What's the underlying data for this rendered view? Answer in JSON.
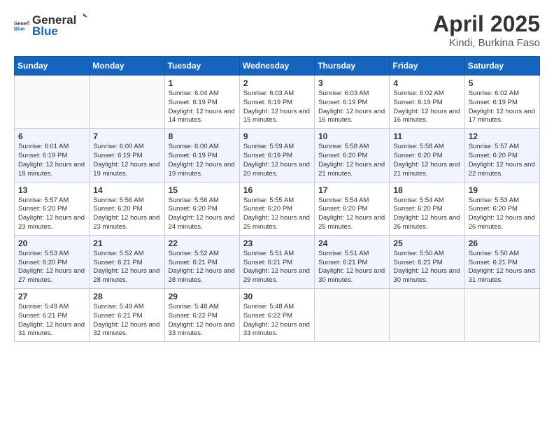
{
  "logo": {
    "general": "General",
    "blue": "Blue"
  },
  "title": {
    "month": "April 2025",
    "location": "Kindi, Burkina Faso"
  },
  "weekdays": [
    "Sunday",
    "Monday",
    "Tuesday",
    "Wednesday",
    "Thursday",
    "Friday",
    "Saturday"
  ],
  "weeks": [
    [
      {
        "day": "",
        "info": ""
      },
      {
        "day": "",
        "info": ""
      },
      {
        "day": "1",
        "info": "Sunrise: 6:04 AM\nSunset: 6:19 PM\nDaylight: 12 hours and 14 minutes."
      },
      {
        "day": "2",
        "info": "Sunrise: 6:03 AM\nSunset: 6:19 PM\nDaylight: 12 hours and 15 minutes."
      },
      {
        "day": "3",
        "info": "Sunrise: 6:03 AM\nSunset: 6:19 PM\nDaylight: 12 hours and 16 minutes."
      },
      {
        "day": "4",
        "info": "Sunrise: 6:02 AM\nSunset: 6:19 PM\nDaylight: 12 hours and 16 minutes."
      },
      {
        "day": "5",
        "info": "Sunrise: 6:02 AM\nSunset: 6:19 PM\nDaylight: 12 hours and 17 minutes."
      }
    ],
    [
      {
        "day": "6",
        "info": "Sunrise: 6:01 AM\nSunset: 6:19 PM\nDaylight: 12 hours and 18 minutes."
      },
      {
        "day": "7",
        "info": "Sunrise: 6:00 AM\nSunset: 6:19 PM\nDaylight: 12 hours and 19 minutes."
      },
      {
        "day": "8",
        "info": "Sunrise: 6:00 AM\nSunset: 6:19 PM\nDaylight: 12 hours and 19 minutes."
      },
      {
        "day": "9",
        "info": "Sunrise: 5:59 AM\nSunset: 6:19 PM\nDaylight: 12 hours and 20 minutes."
      },
      {
        "day": "10",
        "info": "Sunrise: 5:58 AM\nSunset: 6:20 PM\nDaylight: 12 hours and 21 minutes."
      },
      {
        "day": "11",
        "info": "Sunrise: 5:58 AM\nSunset: 6:20 PM\nDaylight: 12 hours and 21 minutes."
      },
      {
        "day": "12",
        "info": "Sunrise: 5:57 AM\nSunset: 6:20 PM\nDaylight: 12 hours and 22 minutes."
      }
    ],
    [
      {
        "day": "13",
        "info": "Sunrise: 5:57 AM\nSunset: 6:20 PM\nDaylight: 12 hours and 23 minutes."
      },
      {
        "day": "14",
        "info": "Sunrise: 5:56 AM\nSunset: 6:20 PM\nDaylight: 12 hours and 23 minutes."
      },
      {
        "day": "15",
        "info": "Sunrise: 5:56 AM\nSunset: 6:20 PM\nDaylight: 12 hours and 24 minutes."
      },
      {
        "day": "16",
        "info": "Sunrise: 5:55 AM\nSunset: 6:20 PM\nDaylight: 12 hours and 25 minutes."
      },
      {
        "day": "17",
        "info": "Sunrise: 5:54 AM\nSunset: 6:20 PM\nDaylight: 12 hours and 25 minutes."
      },
      {
        "day": "18",
        "info": "Sunrise: 5:54 AM\nSunset: 6:20 PM\nDaylight: 12 hours and 26 minutes."
      },
      {
        "day": "19",
        "info": "Sunrise: 5:53 AM\nSunset: 6:20 PM\nDaylight: 12 hours and 26 minutes."
      }
    ],
    [
      {
        "day": "20",
        "info": "Sunrise: 5:53 AM\nSunset: 6:20 PM\nDaylight: 12 hours and 27 minutes."
      },
      {
        "day": "21",
        "info": "Sunrise: 5:52 AM\nSunset: 6:21 PM\nDaylight: 12 hours and 28 minutes."
      },
      {
        "day": "22",
        "info": "Sunrise: 5:52 AM\nSunset: 6:21 PM\nDaylight: 12 hours and 28 minutes."
      },
      {
        "day": "23",
        "info": "Sunrise: 5:51 AM\nSunset: 6:21 PM\nDaylight: 12 hours and 29 minutes."
      },
      {
        "day": "24",
        "info": "Sunrise: 5:51 AM\nSunset: 6:21 PM\nDaylight: 12 hours and 30 minutes."
      },
      {
        "day": "25",
        "info": "Sunrise: 5:50 AM\nSunset: 6:21 PM\nDaylight: 12 hours and 30 minutes."
      },
      {
        "day": "26",
        "info": "Sunrise: 5:50 AM\nSunset: 6:21 PM\nDaylight: 12 hours and 31 minutes."
      }
    ],
    [
      {
        "day": "27",
        "info": "Sunrise: 5:49 AM\nSunset: 6:21 PM\nDaylight: 12 hours and 31 minutes."
      },
      {
        "day": "28",
        "info": "Sunrise: 5:49 AM\nSunset: 6:21 PM\nDaylight: 12 hours and 32 minutes."
      },
      {
        "day": "29",
        "info": "Sunrise: 5:48 AM\nSunset: 6:22 PM\nDaylight: 12 hours and 33 minutes."
      },
      {
        "day": "30",
        "info": "Sunrise: 5:48 AM\nSunset: 6:22 PM\nDaylight: 12 hours and 33 minutes."
      },
      {
        "day": "",
        "info": ""
      },
      {
        "day": "",
        "info": ""
      },
      {
        "day": "",
        "info": ""
      }
    ]
  ]
}
